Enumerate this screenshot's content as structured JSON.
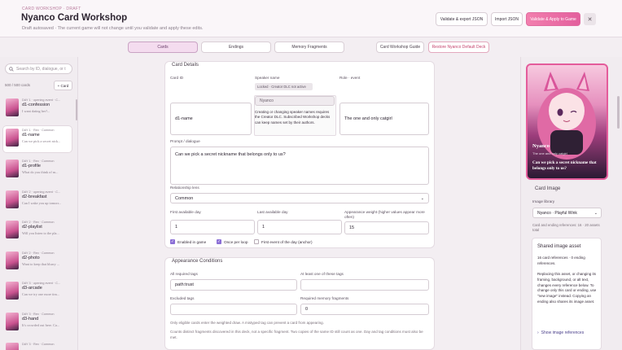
{
  "header": {
    "eyebrow": "CARD WORKSHOP · DRAFT",
    "title": "Nyanco Card Workshop",
    "subtitle": "Draft autosaved · The current game will not change until you validate and apply these edits.",
    "btn_validate_export": "Validate & export JSON",
    "btn_import": "Import JSON",
    "btn_validate_apply": "Validate & Apply to Game",
    "btn_close": "✕"
  },
  "tabs": [
    {
      "label": "Cards"
    },
    {
      "label": "Endings"
    },
    {
      "label": "Memory Fragments"
    },
    {
      "label": "Card Workshop Guide"
    },
    {
      "label": "Restore Nyanco Default Deck"
    }
  ],
  "sidebar": {
    "search_placeholder": "Search by ID, dialogue, or t",
    "count": "500 / 500 cards",
    "add_label": "+ Card",
    "cards": [
      {
        "meta": "DAY 1 · opening event · C...",
        "name": "d1-confession",
        "line": "I want dating her?..."
      },
      {
        "meta": "DAY 1 · Rex · Common",
        "name": "d1-name",
        "line": "Can we pick a secret nick..."
      },
      {
        "meta": "DAY 1 · Rex · Common",
        "name": "d1-profile",
        "line": "What do you think of m..."
      },
      {
        "meta": "DAY 2 · opening event · C...",
        "name": "d2-breakfast",
        "line": "Can I wake you up tomorr..."
      },
      {
        "meta": "DAY 2 · Rex · Common",
        "name": "d2-playlist",
        "line": "Will you listen to the pla..."
      },
      {
        "meta": "DAY 2 · Rex · Common",
        "name": "d2-photo",
        "line": "Want to keep that blurry ..."
      },
      {
        "meta": "DAY 3 · opening event · C...",
        "name": "d3-arcade",
        "line": "Can we try one more tim..."
      },
      {
        "meta": "DAY 3 · Rex · Common",
        "name": "d3-hand",
        "line": "It's crowded out here. Ca..."
      },
      {
        "meta": "DAY 3 · Rex · Common",
        "name": "",
        "line": ""
      }
    ]
  },
  "details": {
    "section_title": "Card Details",
    "card_id_label": "Card ID",
    "card_id_value": "d1-name",
    "speaker_label": "Speaker name",
    "speaker_locked": "Locked · Creator DLC not active",
    "speaker_value": "Nyanco",
    "speaker_tooltip": "Creating or changing speaker names requires the Creator DLC. Subscribed Workshop decks can keep names set by their authors.",
    "role_label": "Role · event",
    "role_value": "The one and only catgirl",
    "prompt_label": "Prompt / dialogue",
    "prompt_value": "Can we pick a secret nickname that belongs only to us?",
    "lens_label": "Relationship lens",
    "lens_value": "Common",
    "first_day_label": "First available day",
    "first_day_value": "1",
    "last_day_label": "Last available day",
    "last_day_value": "1",
    "weight_label": "Appearance weight (higher values appear more often)",
    "weight_value": "15",
    "chk_enabled": "Enabled in game",
    "chk_once": "Once per loop",
    "chk_first": "First event of the day (anchor)"
  },
  "conditions": {
    "section_title": "Appearance Conditions",
    "all_tags_label": "All required tags",
    "all_tags_value": "path:trust",
    "any_tags_label": "At least one of these tags",
    "any_tags_value": "",
    "excluded_label": "Excluded tags",
    "excluded_value": "",
    "memory_label": "Required memory fragments",
    "memory_value": "0",
    "note1": "Only eligible cards enter the weighted draw. A mistyped tag can prevent a card from appearing.",
    "note2": "Counts distinct fragments discovered in this deck, not a specific fragment. Two copies of the same ID still count as one. Day and tag conditions must also be met."
  },
  "preview": {
    "name": "Nyanco",
    "subtitle": "The one and only catgirl",
    "line": "Can we pick a secret nickname that belongs only to us?"
  },
  "image_panel": {
    "title": "Card Image",
    "library_label": "Image library",
    "library_value": "Nyanco · Playful Wink",
    "refs_note": "Card and ending references: 16 · 20 assets total",
    "shared_title": "Shared image asset",
    "shared_refs": "16 card references · 0 ending references.",
    "shared_body": "Replacing this asset, or changing its framing, background, or alt text, changes every reference below. To change only this card or ending, use \"new image\" instead. Copying an ending also shares its image asset.",
    "show_refs": "Show image references"
  },
  "colors": {
    "accent": "#e35f9d",
    "active_tab": "#f4dcef",
    "check": "#8b6fd6"
  }
}
